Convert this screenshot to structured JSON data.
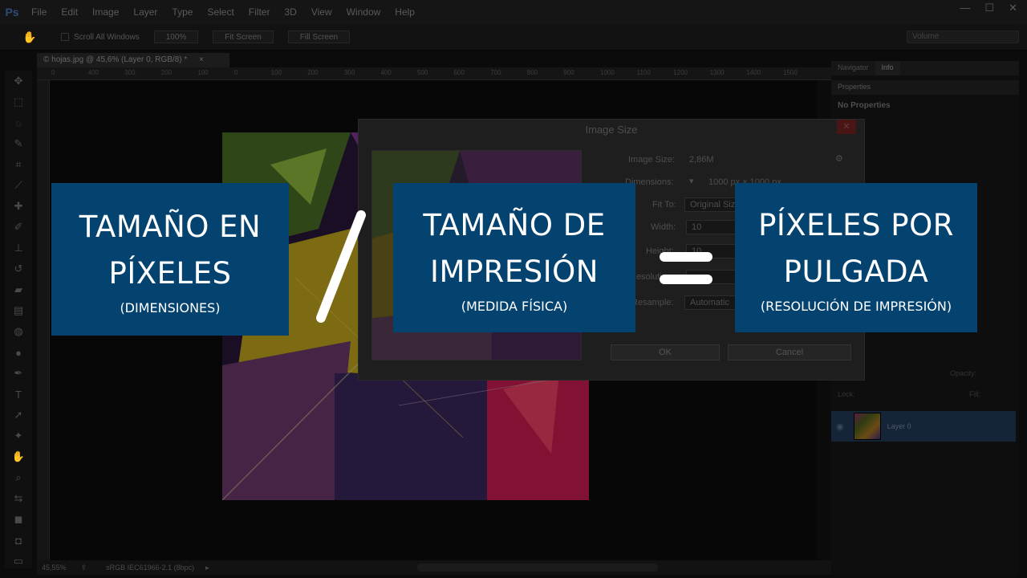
{
  "app": {
    "logo": "Ps",
    "menu": [
      "File",
      "Edit",
      "Image",
      "Layer",
      "Type",
      "Select",
      "Filter",
      "3D",
      "View",
      "Window",
      "Help"
    ],
    "window_controls": [
      "—",
      "☐",
      "✕"
    ]
  },
  "options_bar": {
    "scroll_all_windows": "Scroll All Windows",
    "zoom_100": "100%",
    "fit_screen": "Fit Screen",
    "fill_screen": "Fill Screen",
    "workspace": "Volume"
  },
  "document": {
    "tab_title": "© hojas.jpg @ 45,6% (Layer 0, RGB/8) *",
    "tab_close": "×",
    "ruler_ticks": [
      "0",
      "400",
      "300",
      "200",
      "100",
      "0",
      "100",
      "200",
      "300",
      "400",
      "500",
      "600",
      "700",
      "800",
      "900",
      "1000",
      "1100",
      "1200",
      "1300",
      "1400",
      "1500"
    ],
    "zoom_status": "45,55%",
    "color_profile": "sRGB IEC61966-2.1 (8bpc)"
  },
  "panels": {
    "tabs": [
      "Navigator",
      "Info"
    ],
    "properties_title": "Properties",
    "no_properties": "No Properties",
    "layer_name": "Layer 0",
    "opacity_label": "Opacity:",
    "lock_label": "Lock:",
    "fill_label": "Fill:"
  },
  "dialog": {
    "title": "Image Size",
    "close": "✕",
    "image_size_label": "Image Size:",
    "image_size_value": "2,86M",
    "dimensions_label": "Dimensions:",
    "dimensions_value": "1000 px  ×  1000 px",
    "fit_to_label": "Fit To:",
    "fit_to_value": "Original Size",
    "width_label": "Width:",
    "width_value": "10",
    "height_label": "Height:",
    "height_value": "10",
    "resolution_label": "Resolution:",
    "resample_label": "Resample:",
    "resample_value": "Automatic",
    "ok": "OK",
    "cancel": "Cancel"
  },
  "overlay": {
    "card1": {
      "line1": "TAMAÑO EN",
      "line2": "PÍXELES",
      "sub": "(DIMENSIONES)"
    },
    "card2": {
      "line1": "TAMAÑO DE",
      "line2": "IMPRESIÓN",
      "sub": "(MEDIDA FÍSICA)"
    },
    "card3": {
      "line1": "PÍXELES POR",
      "line2": "PULGADA",
      "sub": "(RESOLUCIÓN DE IMPRESIÓN)"
    },
    "card_color": "#04426f",
    "operator_color": "#ffffff"
  }
}
